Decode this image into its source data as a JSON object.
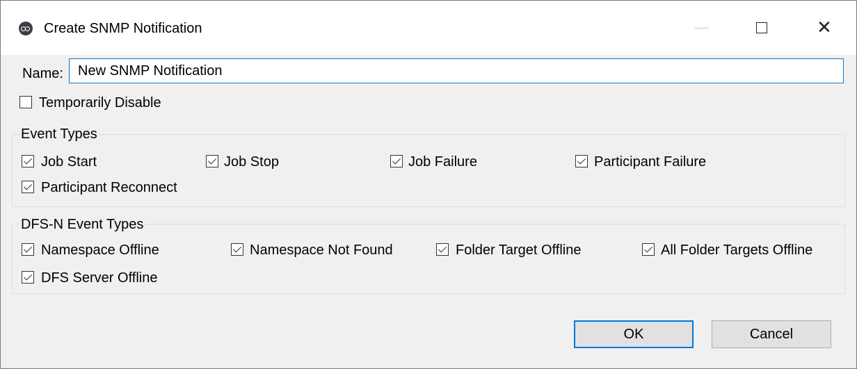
{
  "window": {
    "title": "Create SNMP Notification",
    "icon": "peer-app-icon",
    "controls": {
      "minimize": "—",
      "maximize": "☐",
      "close": "✕"
    }
  },
  "name_field": {
    "label": "Name:",
    "value": "New SNMP Notification"
  },
  "temporarily_disable": {
    "label": "Temporarily Disable",
    "checked": false
  },
  "event_types": {
    "title": "Event Types",
    "items": [
      {
        "label": "Job Start",
        "checked": true
      },
      {
        "label": "Job Stop",
        "checked": true
      },
      {
        "label": "Job Failure",
        "checked": true
      },
      {
        "label": "Participant Failure",
        "checked": true
      },
      {
        "label": "Participant Reconnect",
        "checked": true
      }
    ]
  },
  "dfsn_event_types": {
    "title": "DFS-N Event Types",
    "items": [
      {
        "label": "Namespace Offline",
        "checked": true
      },
      {
        "label": "Namespace Not Found",
        "checked": true
      },
      {
        "label": "Folder Target Offline",
        "checked": true
      },
      {
        "label": "All Folder Targets Offline",
        "checked": true
      },
      {
        "label": "DFS Server Offline",
        "checked": true
      }
    ]
  },
  "buttons": {
    "ok": "OK",
    "cancel": "Cancel"
  },
  "colors": {
    "accent": "#0078d7",
    "dialog_bg": "#f0f0f0",
    "titlebar_bg": "#ffffff"
  }
}
